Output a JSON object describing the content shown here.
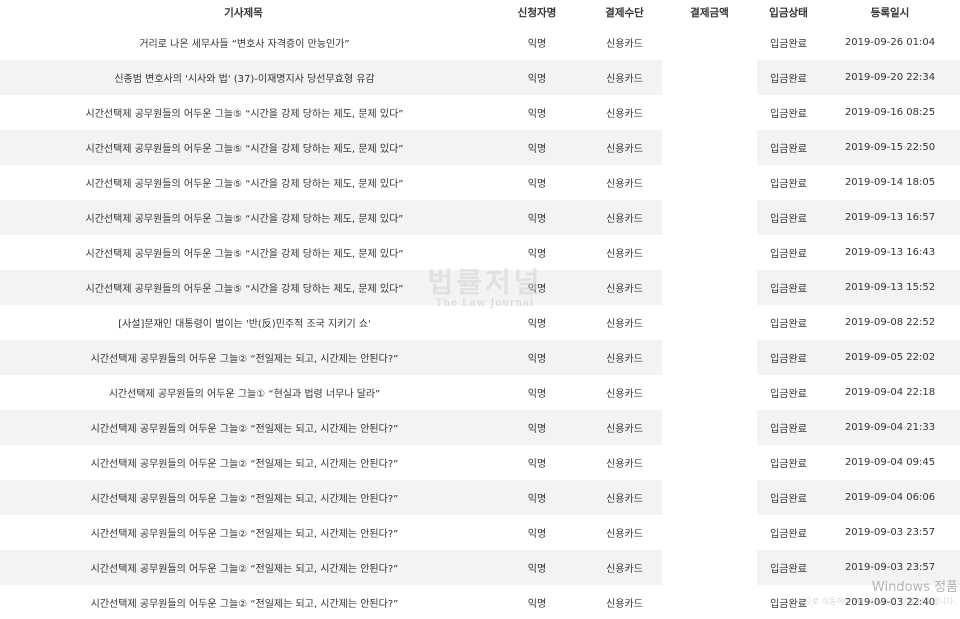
{
  "table": {
    "headers": {
      "title": "기사제목",
      "name": "신청자명",
      "method": "결제수단",
      "amount": "결제금액",
      "status": "입금상태",
      "date": "등록일시"
    },
    "rows": [
      {
        "title": "거리로 나온 세무사들 “변호사 자격증이 만능인가”",
        "name": "익명",
        "method": "신용카드",
        "amount": "",
        "status": "입금완료",
        "date": "2019-09-26 01:04"
      },
      {
        "title": "신종범 변호사의 '시사와 법' (37)-이재명지사 당선무효형 유감",
        "name": "익명",
        "method": "신용카드",
        "amount": "",
        "status": "입금완료",
        "date": "2019-09-20 22:34"
      },
      {
        "title": "시간선택제 공무원들의 어두운 그늘⑤ “시간을 강제 당하는 제도, 문제 있다”",
        "name": "익명",
        "method": "신용카드",
        "amount": "",
        "status": "입금완료",
        "date": "2019-09-16 08:25"
      },
      {
        "title": "시간선택제 공무원들의 어두운 그늘⑤ “시간을 강제 당하는 제도, 문제 있다”",
        "name": "익명",
        "method": "신용카드",
        "amount": "",
        "status": "입금완료",
        "date": "2019-09-15 22:50"
      },
      {
        "title": "시간선택제 공무원들의 어두운 그늘⑤ “시간을 강제 당하는 제도, 문제 있다”",
        "name": "익명",
        "method": "신용카드",
        "amount": "",
        "status": "입금완료",
        "date": "2019-09-14 18:05"
      },
      {
        "title": "시간선택제 공무원들의 어두운 그늘⑤ “시간을 강제 당하는 제도, 문제 있다”",
        "name": "익명",
        "method": "신용카드",
        "amount": "",
        "status": "입금완료",
        "date": "2019-09-13 16:57"
      },
      {
        "title": "시간선택제 공무원들의 어두운 그늘⑤ “시간을 강제 당하는 제도, 문제 있다”",
        "name": "익명",
        "method": "신용카드",
        "amount": "",
        "status": "입금완료",
        "date": "2019-09-13 16:43"
      },
      {
        "title": "시간선택제 공무원들의 어두운 그늘⑤ “시간을 강제 당하는 제도, 문제 있다”",
        "name": "익명",
        "method": "신용카드",
        "amount": "",
        "status": "입금완료",
        "date": "2019-09-13 15:52"
      },
      {
        "title": "[사설]문재인 대통령이 벌이는 '반(反)민주적 조국 지키기 쇼'",
        "name": "익명",
        "method": "신용카드",
        "amount": "",
        "status": "입금완료",
        "date": "2019-09-08 22:52"
      },
      {
        "title": "시간선택제 공무원들의 어두운 그늘② “전일제는 되고, 시간제는 안된다?”",
        "name": "익명",
        "method": "신용카드",
        "amount": "",
        "status": "입금완료",
        "date": "2019-09-05 22:02"
      },
      {
        "title": "시간선택제 공무원들의 어두운 그늘① “현실과 법령 너무나 달라”",
        "name": "익명",
        "method": "신용카드",
        "amount": "",
        "status": "입금완료",
        "date": "2019-09-04 22:18"
      },
      {
        "title": "시간선택제 공무원들의 어두운 그늘② “전일제는 되고, 시간제는 안된다?”",
        "name": "익명",
        "method": "신용카드",
        "amount": "",
        "status": "입금완료",
        "date": "2019-09-04 21:33"
      },
      {
        "title": "시간선택제 공무원들의 어두운 그늘② “전일제는 되고, 시간제는 안된다?”",
        "name": "익명",
        "method": "신용카드",
        "amount": "",
        "status": "입금완료",
        "date": "2019-09-04 09:45"
      },
      {
        "title": "시간선택제 공무원들의 어두운 그늘② “전일제는 되고, 시간제는 안된다?”",
        "name": "익명",
        "method": "신용카드",
        "amount": "",
        "status": "입금완료",
        "date": "2019-09-04 06:06"
      },
      {
        "title": "시간선택제 공무원들의 어두운 그늘② “전일제는 되고, 시간제는 안된다?”",
        "name": "익명",
        "method": "신용카드",
        "amount": "",
        "status": "입금완료",
        "date": "2019-09-03 23:57"
      },
      {
        "title": "시간선택제 공무원들의 어두운 그늘② “전일제는 되고, 시간제는 안된다?”",
        "name": "익명",
        "method": "신용카드",
        "amount": "",
        "status": "입금완료",
        "date": "2019-09-03 23:57"
      },
      {
        "title": "시간선택제 공무원들의 어두운 그늘② “전일제는 되고, 시간제는 안된다?”",
        "name": "익명",
        "method": "신용카드",
        "amount": "",
        "status": "입금완료",
        "date": "2019-09-03 22:40"
      }
    ]
  },
  "watermark": {
    "logo": "법률저널",
    "subtitle": "The Law Journal"
  },
  "activation": {
    "text": "Windows 정품",
    "subtext": "설정으로 이동하여 Windows를 정품 인증합니다."
  }
}
